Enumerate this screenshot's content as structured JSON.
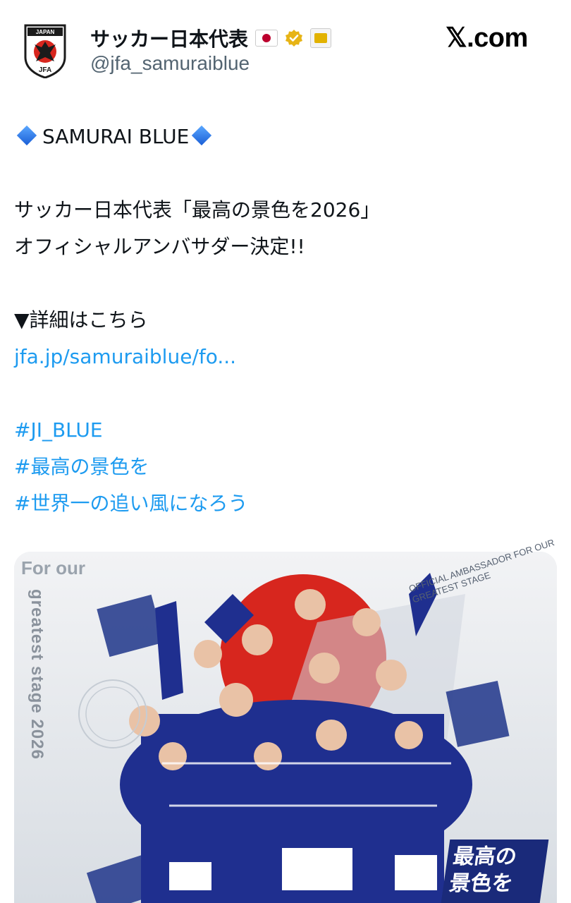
{
  "account": {
    "display_name": "サッカー日本代表",
    "handle": "@jfa_samuraiblue",
    "logo_text_top": "JAPAN",
    "logo_text_bottom": "JFA",
    "badges": [
      "japan-flag-icon",
      "verified-gold-icon",
      "affiliate-badge-icon"
    ]
  },
  "brand": {
    "site": "𝕏.com"
  },
  "tweet": {
    "title": "SAMURAI BLUE",
    "line1": "サッカー日本代表「最高の景色を2026」",
    "line2": "オフィシャルアンバサダー決定!!",
    "details": "▼詳細はこちら",
    "link": "jfa.jp/samuraiblue/fo...",
    "hashtags": [
      "#JI_BLUE",
      "#最高の景色を",
      "#世界一の追い風になろう"
    ]
  },
  "media": {
    "poster_top_text": "For our",
    "poster_vertical_text": "greatest stage 2026",
    "poster_ambassador_text": "OFFICIAL AMBASSADOR FOR OUR GREATEST STAGE",
    "poster_title": "最高の 景色を"
  },
  "colors": {
    "link": "#1d9bf0",
    "handle": "#536471",
    "jersey_blue": "#1f2f8f",
    "sun_red": "#d7261e",
    "verified": "#e7b416"
  }
}
